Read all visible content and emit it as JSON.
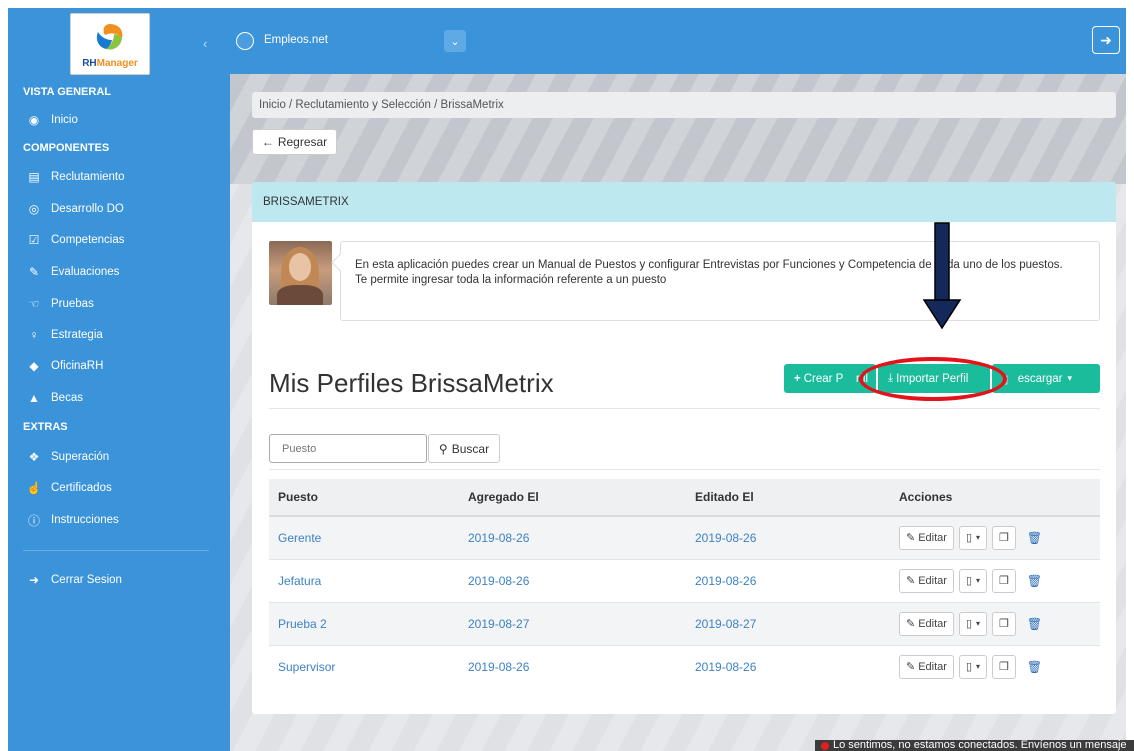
{
  "sidebar": {
    "logo_text_a": "RH",
    "logo_text_b": "Manager",
    "collapse": "‹",
    "sections": {
      "general": "VISTA GENERAL",
      "components": "COMPONENTES",
      "extras": "EXTRAS"
    },
    "items": [
      {
        "label": "Inicio",
        "icon": "dashboard-icon"
      },
      {
        "label": "Reclutamiento",
        "icon": "calendar-icon"
      },
      {
        "label": "Desarrollo DO",
        "icon": "eye-icon"
      },
      {
        "label": "Competencias",
        "icon": "checkbox-icon"
      },
      {
        "label": "Evaluaciones",
        "icon": "edit-icon"
      },
      {
        "label": "Pruebas",
        "icon": "hand-icon"
      },
      {
        "label": "Estrategia",
        "icon": "lightbulb-icon"
      },
      {
        "label": "OficinaRH",
        "icon": "diamond-icon"
      },
      {
        "label": "Becas",
        "icon": "graduation-cap-icon"
      },
      {
        "label": "Superación",
        "icon": "cubes-icon"
      },
      {
        "label": "Certificados",
        "icon": "hand-pointer-icon"
      },
      {
        "label": "Instrucciones",
        "icon": "info-icon"
      },
      {
        "label": "Cerrar Sesion",
        "icon": "sign-out-icon"
      }
    ]
  },
  "topbar": {
    "brand": "Empleos.net",
    "dropdown": "⌄",
    "logout_icon": "➜"
  },
  "breadcrumb": "Inicio / Reclutamiento y Selección / BrissaMetrix",
  "back_button": "Regresar",
  "card": {
    "header": "BRISSAMETRIX",
    "info_line1": "En esta aplicación puedes crear un Manual de Puestos y configurar Entrevistas por Funciones y Competencia   de cada uno de los puestos.",
    "info_line2": "Te permite ingresar toda la información referente a un puesto",
    "title": "Mis Perfiles BrissaMetrix",
    "buttons": {
      "create": "Crear P    rfil",
      "import": "Importar Perfil",
      "download": "  escargar"
    },
    "search_placeholder": "Puesto",
    "search_button": "Buscar",
    "table": {
      "headers": [
        "Puesto",
        "Agregado El",
        "Editado El",
        "Acciones"
      ],
      "rows": [
        {
          "puesto": "Gerente",
          "agregado": "2019-08-26",
          "editado": "2019-08-26"
        },
        {
          "puesto": "Jefatura",
          "agregado": "2019-08-26",
          "editado": "2019-08-26"
        },
        {
          "puesto": "Prueba 2",
          "agregado": "2019-08-27",
          "editado": "2019-08-27"
        },
        {
          "puesto": "Supervisor",
          "agregado": "2019-08-26",
          "editado": "2019-08-26"
        }
      ],
      "edit_label": "Editar"
    }
  },
  "chat": "Lo sentimos, no estamos conectados. Envíenos un mensaje",
  "colors": {
    "primary": "#3b93da",
    "green": "#1bbc9b",
    "header_band": "#bde8f0",
    "annotation_red": "#e0141a"
  }
}
